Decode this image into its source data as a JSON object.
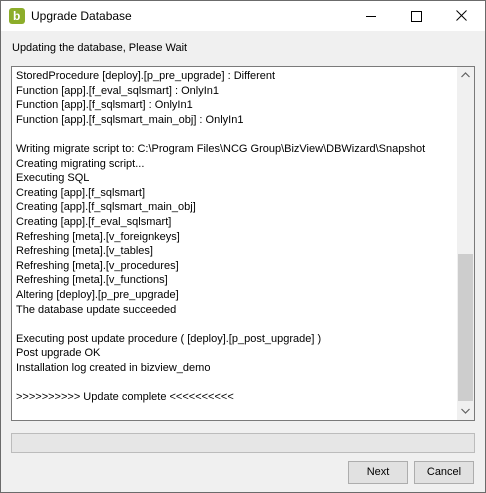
{
  "window": {
    "title": "Upgrade Database",
    "app_icon_letter": "b",
    "controls": [
      "minimize",
      "maximize",
      "close"
    ]
  },
  "status_text": "Updating the database, Please Wait",
  "log_lines": [
    "StoredProcedure [deploy].[p_pre_upgrade] : Different",
    "Function [app].[f_eval_sqlsmart] : OnlyIn1",
    "Function [app].[f_sqlsmart] : OnlyIn1",
    "Function [app].[f_sqlsmart_main_obj] : OnlyIn1",
    "",
    "Writing migrate script to: C:\\Program Files\\NCG Group\\BizView\\DBWizard\\Snapshot",
    "Creating migrating script...",
    "Executing SQL",
    "Creating [app].[f_sqlsmart]",
    "Creating [app].[f_sqlsmart_main_obj]",
    "Creating [app].[f_eval_sqlsmart]",
    "Refreshing [meta].[v_foreignkeys]",
    "Refreshing [meta].[v_tables]",
    "Refreshing [meta].[v_procedures]",
    "Refreshing [meta].[v_functions]",
    "Altering [deploy].[p_pre_upgrade]",
    "The database update succeeded",
    "",
    "Executing post update procedure ( [deploy].[p_post_upgrade] )",
    "Post upgrade OK",
    "Installation log created in bizview_demo",
    "",
    ">>>>>>>>>> Update complete <<<<<<<<<<"
  ],
  "progress_fraction": 0,
  "buttons": {
    "next_label": "Next",
    "cancel_label": "Cancel"
  }
}
